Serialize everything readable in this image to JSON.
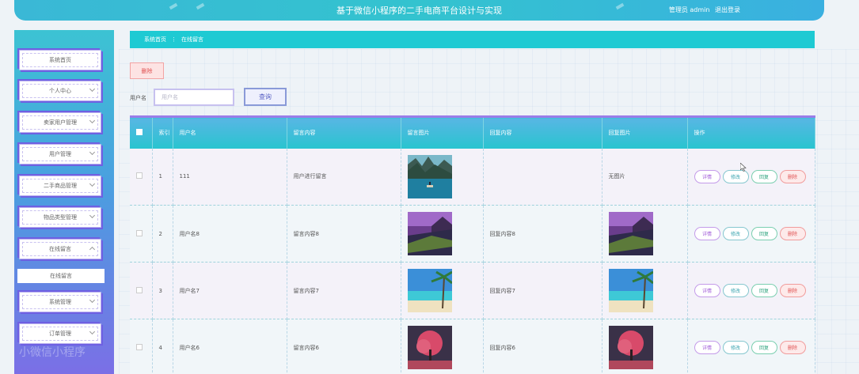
{
  "header": {
    "title": "基于微信小程序的二手电商平台设计与实现",
    "role": "管理员 admin",
    "logout": "退出登录"
  },
  "sidebar": {
    "items": [
      {
        "label": "系统首页",
        "chevron": "none"
      },
      {
        "label": "个人中心",
        "chevron": "down"
      },
      {
        "label": "卖家用户管理",
        "chevron": "down"
      },
      {
        "label": "用户管理",
        "chevron": "down"
      },
      {
        "label": "二手商品管理",
        "chevron": "down"
      },
      {
        "label": "物品类型管理",
        "chevron": "down"
      },
      {
        "label": "在线留言",
        "chevron": "up"
      },
      {
        "label": "系统管理",
        "chevron": "down"
      },
      {
        "label": "订单管理",
        "chevron": "down"
      }
    ],
    "submenu": {
      "label": "在线留言"
    },
    "watermark": "小微信小程序"
  },
  "breadcrumb": {
    "home": "系统首页",
    "sep": "⋮",
    "current": "在线留言"
  },
  "toolbar": {
    "delete_label": "删除",
    "search_label": "用户名",
    "search_placeholder": "用户名",
    "search_value": "",
    "query_label": "查询"
  },
  "table": {
    "headers": [
      "",
      "索引",
      "用户名",
      "留言内容",
      "留言图片",
      "回复内容",
      "回复图片",
      "操作"
    ],
    "op_labels": {
      "detail": "详情",
      "edit": "修改",
      "reply": "回复",
      "delete": "删除"
    },
    "rows": [
      {
        "index": "1",
        "username": "111",
        "content": "用户进行留言",
        "image": "lake-boat",
        "reply": "",
        "reply_image": "",
        "reply_image_text": "无图片"
      },
      {
        "index": "2",
        "username": "用户名8",
        "content": "留言内容8",
        "image": "coast-sunset",
        "reply": "回复内容8",
        "reply_image": "coast-sunset",
        "reply_image_text": ""
      },
      {
        "index": "3",
        "username": "用户名7",
        "content": "留言内容7",
        "image": "palm-beach",
        "reply": "回复内容7",
        "reply_image": "palm-beach",
        "reply_image_text": ""
      },
      {
        "index": "4",
        "username": "用户名6",
        "content": "留言内容6",
        "image": "pink-tree",
        "reply": "回复内容6",
        "reply_image": "pink-tree",
        "reply_image_text": ""
      }
    ]
  },
  "colors": {
    "header": "#33c3cf",
    "breadcrumb": "#1ecad3",
    "sidebar_top": "#3cc3d3",
    "sidebar_bottom": "#7b6fe6",
    "delete": "#e05353"
  }
}
